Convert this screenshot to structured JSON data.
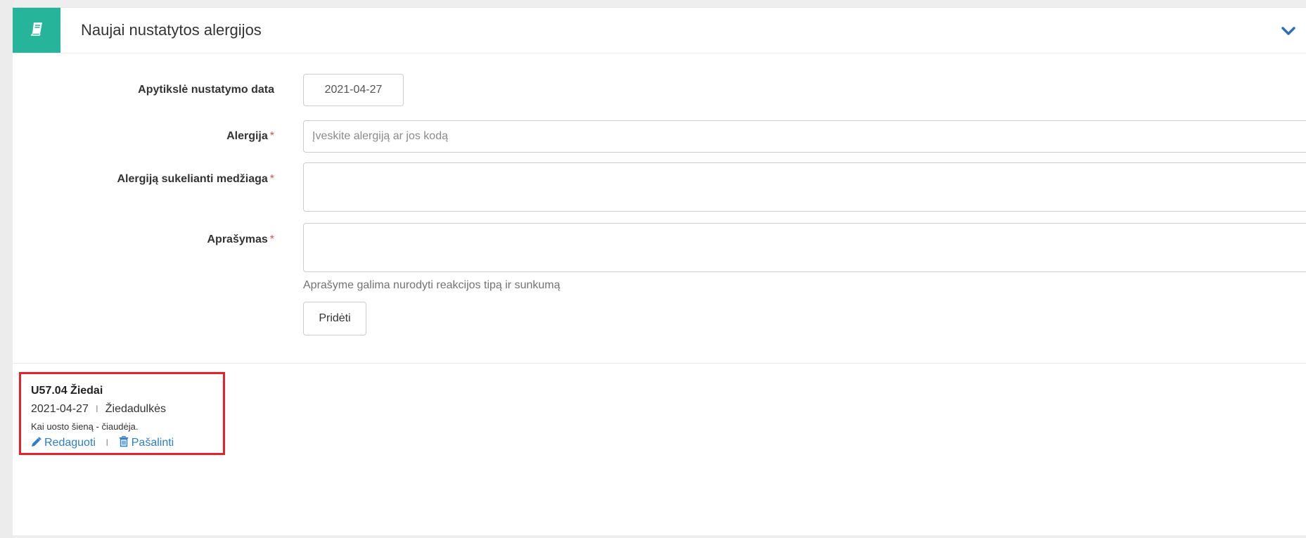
{
  "panel": {
    "title": "Naujai nustatytos alergijos",
    "icon": "book-icon",
    "toggle_icon": "chevron-down-icon",
    "accent_color": "#26b49a"
  },
  "form": {
    "date_label": "Apytikslė nustatymo data",
    "date_value": "2021-04-27",
    "allergy_label": "Alergija",
    "allergy_placeholder": "Įveskite alergiją ar jos kodą",
    "substance_label": "Alergiją sukelianti medžiaga",
    "substance_value": "",
    "description_label": "Aprašymas",
    "description_value": "",
    "description_help": "Aprašyme galima nurodyti reakcijos tipą ir sunkumą",
    "required_mark": "*",
    "add_button": "Pridėti"
  },
  "entries": [
    {
      "title": "U57.04 Žiedai",
      "date": "2021-04-27",
      "separator": "I",
      "substance": "Žiedadulkės",
      "description": "Kai uosto šieną - čiaudėja.",
      "edit_label": "Redaguoti",
      "edit_icon": "pencil-icon",
      "remove_label": "Pašalinti",
      "remove_icon": "trash-icon"
    }
  ],
  "colors": {
    "link": "#2d7ec7",
    "required": "#d9534f",
    "highlight_border": "#e8202a"
  }
}
